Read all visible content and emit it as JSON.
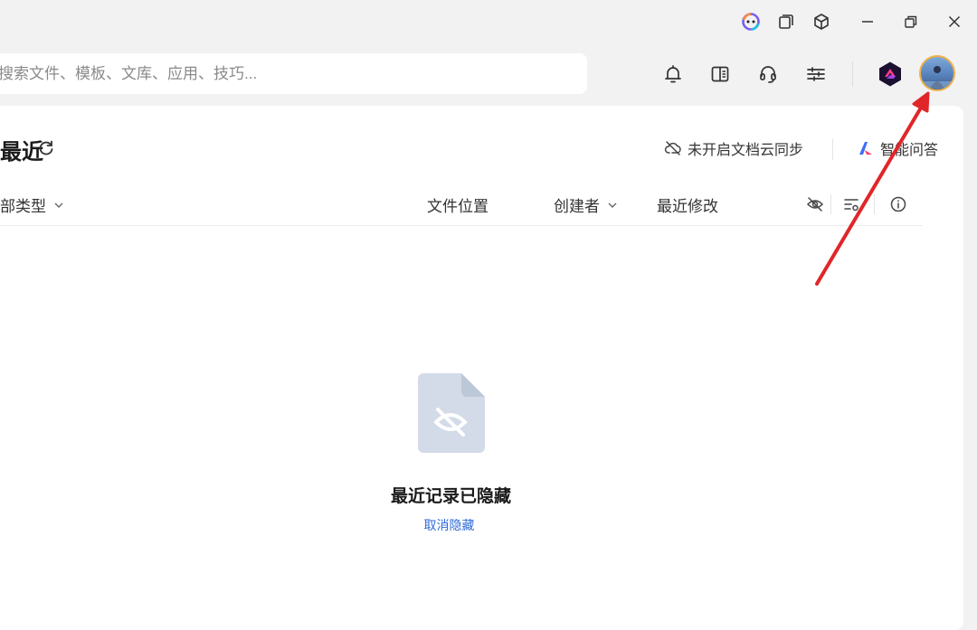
{
  "window": {
    "icons": [
      "copilot-icon",
      "multi-window-icon",
      "cube-icon",
      "minimize-icon",
      "restore-icon",
      "close-icon"
    ]
  },
  "search": {
    "placeholder": "搜索文件、模板、文库、应用、技巧..."
  },
  "toolbar": {
    "icons": [
      "bell-icon",
      "sidebar-panel-icon",
      "headset-icon",
      "sliders-icon",
      "app-logo-icon",
      "avatar"
    ]
  },
  "main": {
    "title": "最近",
    "sync_label": "未开启文档云同步",
    "ai_label": "智能问答",
    "columns": {
      "type_filter": "部类型",
      "location": "文件位置",
      "creator": "创建者",
      "modified": "最近修改"
    },
    "empty_state": {
      "title": "最近记录已隐藏",
      "action": "取消隐藏"
    }
  },
  "colors": {
    "accent_link": "#2f6bd8",
    "annotation_arrow": "#e0262a",
    "avatar_ring": "#f0b24a",
    "window_bg": "#f2f2f3"
  }
}
